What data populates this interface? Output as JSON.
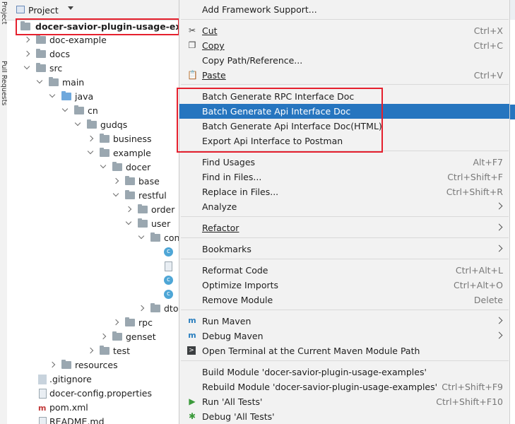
{
  "sidebar": {
    "project_tab": "Project",
    "pull_requests_tab": "Pull Requests"
  },
  "panel": {
    "title": "Project"
  },
  "tree": {
    "root": "docer-savior-plugin-usage-exam",
    "doc_example": "doc-example",
    "docs": "docs",
    "src": "src",
    "main": "main",
    "java": "java",
    "cn": "cn",
    "gudqs": "gudqs",
    "business": "business",
    "example": "example",
    "docer": "docer",
    "base": "base",
    "restful": "restful",
    "order": "order",
    "user": "user",
    "con": "con",
    "dto": "dto",
    "rpc": "rpc",
    "genset": "genset",
    "test": "test",
    "resources": "resources",
    "gitignore": ".gitignore",
    "docer_config": "docer-config.properties",
    "pom": "pom.xml",
    "readme": "README.md"
  },
  "menu": {
    "add_framework": "Add Framework Support...",
    "cut": "Cut",
    "cut_shortcut": "Ctrl+X",
    "copy": "Copy",
    "copy_shortcut": "Ctrl+C",
    "copy_path": "Copy Path/Reference...",
    "paste": "Paste",
    "paste_shortcut": "Ctrl+V",
    "batch_rpc": "Batch Generate RPC Interface Doc",
    "batch_api": "Batch Generate Api Interface Doc",
    "batch_api_html": "Batch Generate Api Interface Doc(HTML)",
    "export_postman": "Export Api Interface to Postman",
    "find_usages": "Find Usages",
    "find_usages_shortcut": "Alt+F7",
    "find_in_files": "Find in Files...",
    "find_in_files_shortcut": "Ctrl+Shift+F",
    "replace_in_files": "Replace in Files...",
    "replace_in_files_shortcut": "Ctrl+Shift+R",
    "analyze": "Analyze",
    "refactor": "Refactor",
    "bookmarks": "Bookmarks",
    "reformat": "Reformat Code",
    "reformat_shortcut": "Ctrl+Alt+L",
    "optimize": "Optimize Imports",
    "optimize_shortcut": "Ctrl+Alt+O",
    "remove_module": "Remove Module",
    "remove_module_shortcut": "Delete",
    "run_maven": "Run Maven",
    "debug_maven": "Debug Maven",
    "open_terminal": "Open Terminal at the Current Maven Module Path",
    "build_module": "Build Module 'docer-savior-plugin-usage-examples'",
    "rebuild_module": "Rebuild Module 'docer-savior-plugin-usage-examples'",
    "rebuild_shortcut": "Ctrl+Shift+F9",
    "run_tests": "Run 'All Tests'",
    "run_tests_shortcut": "Ctrl+Shift+F10",
    "debug_tests": "Debug 'All Tests'"
  },
  "colors": {
    "selection": "#2675bf",
    "highlight_box": "#e5202e",
    "menu_bg": "#f2f2f2"
  }
}
